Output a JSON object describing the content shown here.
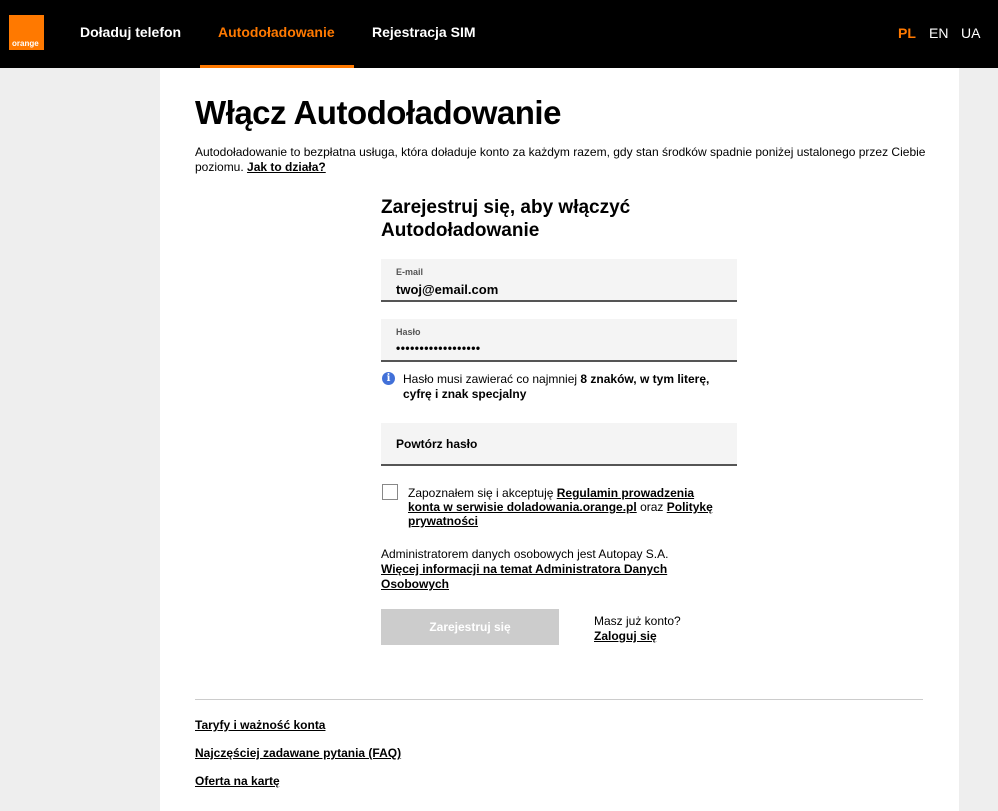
{
  "header": {
    "logo_text": "orange",
    "nav": [
      {
        "label": "Doładuj telefon",
        "active": false
      },
      {
        "label": "Autodoładowanie",
        "active": true
      },
      {
        "label": "Rejestracja SIM",
        "active": false
      }
    ],
    "languages": [
      {
        "code": "PL",
        "active": true
      },
      {
        "code": "EN",
        "active": false
      },
      {
        "code": "UA",
        "active": false
      }
    ]
  },
  "main": {
    "title": "Włącz Autodoładowanie",
    "intro_text": "Autodoładowanie to bezpłatna usługa, która doładuje konto za każdym razem, gdy stan środków spadnie poniżej ustalonego przez Ciebie poziomu. ",
    "intro_link": "Jak to działa?"
  },
  "form": {
    "title": "Zarejestruj się, aby włączyć Autodoładowanie",
    "email": {
      "label": "E-mail",
      "value": "twoj@email.com"
    },
    "password": {
      "label": "Hasło",
      "value": "••••••••••••••••••"
    },
    "hint_prefix": "Hasło musi zawierać co najmniej ",
    "hint_bold": "8 znaków, w tym literę, cyfrę i znak specjalny",
    "repeat_password": {
      "placeholder": "Powtórz hasło"
    },
    "consent_prefix": "Zapoznałem się i akceptuję ",
    "consent_link1": "Regulamin prowadzenia konta w serwisie doladowania.orange.pl",
    "consent_mid": " oraz ",
    "consent_link2": "Politykę prywatności",
    "admin_text": "Administratorem danych osobowych jest Autopay S.A.",
    "admin_link": "Więcej informacji na temat Administratora Danych Osobowych",
    "register_label": "Zarejestruj się",
    "have_account": "Masz już konto?",
    "login_link": "Zaloguj się"
  },
  "footer": {
    "links": [
      "Taryfy i ważność konta",
      "Najczęściej zadawane pytania (FAQ)",
      "Oferta na kartę"
    ]
  },
  "colors": {
    "brand": "#ff7900",
    "header_bg": "#000000",
    "info": "#4170d8"
  }
}
